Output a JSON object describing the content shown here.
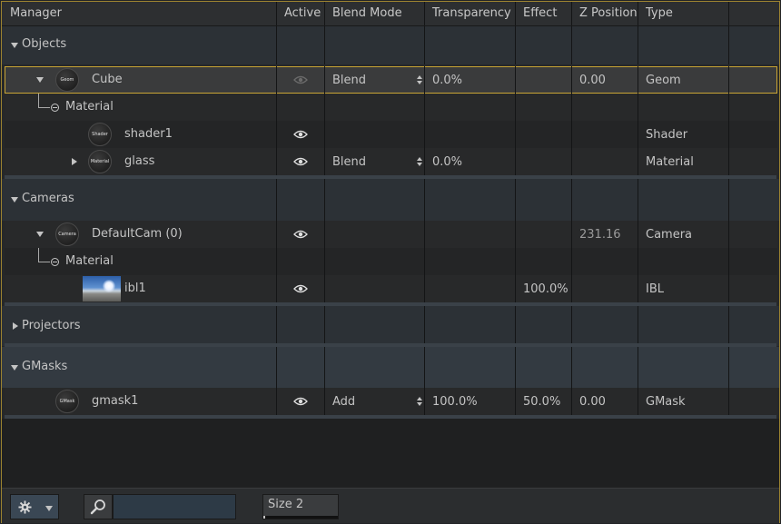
{
  "header": {
    "columns": [
      "Manager",
      "Active",
      "Blend Mode",
      "Transparency",
      "Effect",
      "Z Position",
      "Type"
    ]
  },
  "colors": {
    "accent": "#c9a535",
    "selection_bg": "#3a3b3c",
    "group_bg": "#2c3136"
  },
  "groups": {
    "objects": {
      "label": "Objects",
      "expanded": true
    },
    "cameras": {
      "label": "Cameras",
      "expanded": true
    },
    "projectors": {
      "label": "Projectors",
      "expanded": false
    },
    "gmasks": {
      "label": "GMasks",
      "expanded": true
    }
  },
  "rows": {
    "cube": {
      "thumb": "Geom",
      "name": "Cube",
      "blend": "Blend",
      "transparency": "0.0%",
      "effect": "",
      "zpos": "0.00",
      "type": "Geom",
      "active": true,
      "selected": true
    },
    "material1": {
      "name": "Material"
    },
    "shader1": {
      "thumb": "Shader",
      "name": "shader1",
      "type": "Shader",
      "active": true
    },
    "glass": {
      "thumb": "Material",
      "name": "glass",
      "blend": "Blend",
      "transparency": "0.0%",
      "type": "Material",
      "active": true
    },
    "defaultcam": {
      "thumb": "Camera",
      "name": "DefaultCam (0)",
      "zpos": "231.16",
      "type": "Camera",
      "active": true
    },
    "material2": {
      "name": "Material"
    },
    "ibl1": {
      "name": "ibl1",
      "effect": "100.0%",
      "type": "IBL",
      "active": true
    },
    "gmask1": {
      "thumb": "GMask",
      "name": "gmask1",
      "blend": "Add",
      "transparency": "100.0%",
      "effect": "50.0%",
      "zpos": "0.00",
      "type": "GMask",
      "active": true
    }
  },
  "footer": {
    "search_value": "",
    "size_label": "Size 2",
    "size_level": 0.02
  },
  "icons": {
    "gear": "gear-icon",
    "search": "magnifier-icon",
    "eye": "eye-icon"
  }
}
